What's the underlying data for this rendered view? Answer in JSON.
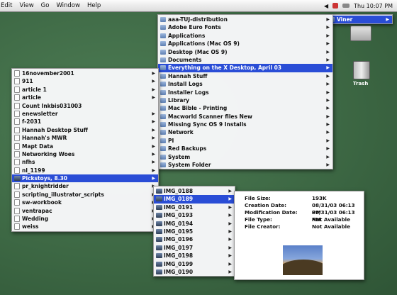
{
  "menubar": {
    "items": [
      "Edit",
      "View",
      "Go",
      "Window",
      "Help"
    ],
    "clock": "Thu 10:07 PM",
    "volume_icon": "speaker-icon",
    "flag_icon": "flag-icon",
    "battery_icon": "battery-icon"
  },
  "left_menu": {
    "items": [
      {
        "label": "16november2001",
        "icon": "doc",
        "arrow": true
      },
      {
        "label": "911",
        "icon": "doc",
        "arrow": true
      },
      {
        "label": "article 1",
        "icon": "doc",
        "arrow": true
      },
      {
        "label": "article",
        "icon": "doc",
        "arrow": true
      },
      {
        "label": "Count Inkbis031003",
        "icon": "doc",
        "arrow": false
      },
      {
        "label": "enewsletter",
        "icon": "doc",
        "arrow": true
      },
      {
        "label": "f-2031",
        "icon": "doc",
        "arrow": true
      },
      {
        "label": "Hannah Desktop Stuff",
        "icon": "doc",
        "arrow": true
      },
      {
        "label": "Hannah's MWR",
        "icon": "doc",
        "arrow": true
      },
      {
        "label": "Mapt Data",
        "icon": "doc",
        "arrow": true
      },
      {
        "label": "Networking Woes",
        "icon": "doc",
        "arrow": true
      },
      {
        "label": "nfhs",
        "icon": "doc",
        "arrow": true
      },
      {
        "label": "nl_1199",
        "icon": "doc",
        "arrow": true
      },
      {
        "label": "Pickstoys, 8.30",
        "icon": "img",
        "arrow": true,
        "selected": true
      },
      {
        "label": "pr_knightridder",
        "icon": "doc",
        "arrow": true
      },
      {
        "label": "scripting_illustrator_scripts",
        "icon": "doc",
        "arrow": true
      },
      {
        "label": "sw-workbook",
        "icon": "doc",
        "arrow": true
      },
      {
        "label": "ventrapac",
        "icon": "doc",
        "arrow": true
      },
      {
        "label": "Wedding",
        "icon": "doc",
        "arrow": true
      },
      {
        "label": "weiss",
        "icon": "doc",
        "arrow": true
      }
    ]
  },
  "middle_menu": {
    "items": [
      {
        "label": "aaa-TUJ-distribution",
        "icon": "folder",
        "arrow": true
      },
      {
        "label": "Adobe Euro Fonts",
        "icon": "folder",
        "arrow": true
      },
      {
        "label": "Applications",
        "icon": "folder",
        "arrow": true
      },
      {
        "label": "Applications (Mac OS 9)",
        "icon": "folder",
        "arrow": true
      },
      {
        "label": "Desktop (Mac OS 9)",
        "icon": "folder",
        "arrow": true
      },
      {
        "label": "Documents",
        "icon": "folder",
        "arrow": true
      },
      {
        "label": "Everything on the X Desktop, April 03",
        "icon": "folder",
        "arrow": true,
        "selected": true
      },
      {
        "label": "Hannah Stuff",
        "icon": "folder",
        "arrow": true
      },
      {
        "label": "Install Logs",
        "icon": "folder",
        "arrow": true
      },
      {
        "label": "Installer Logs",
        "icon": "folder",
        "arrow": true
      },
      {
        "label": "Library",
        "icon": "folder",
        "arrow": true
      },
      {
        "label": "Mac Bible - Printing",
        "icon": "folder",
        "arrow": true
      },
      {
        "label": "Macworld Scanner files New",
        "icon": "folder",
        "arrow": true
      },
      {
        "label": "Missing Sync OS 9 Installs",
        "icon": "folder",
        "arrow": true
      },
      {
        "label": "Network",
        "icon": "folder",
        "arrow": true
      },
      {
        "label": "PI",
        "icon": "folder",
        "arrow": true
      },
      {
        "label": "Red Backups",
        "icon": "folder",
        "arrow": true
      },
      {
        "label": "System",
        "icon": "folder",
        "arrow": true
      },
      {
        "label": "System Folder",
        "icon": "folder",
        "arrow": true
      }
    ]
  },
  "top_right_menu": {
    "items": [
      {
        "label": "Viner",
        "icon": "folder",
        "arrow": true,
        "selected": true
      }
    ]
  },
  "image_menu": {
    "items": [
      {
        "label": "IMG_0188",
        "icon": "img",
        "arrow": true
      },
      {
        "label": "IMG_0189",
        "icon": "img",
        "arrow": true,
        "selected": true
      },
      {
        "label": "IMG_0191",
        "icon": "img",
        "arrow": true
      },
      {
        "label": "IMG_0193",
        "icon": "img",
        "arrow": true
      },
      {
        "label": "IMG_0194",
        "icon": "img",
        "arrow": true
      },
      {
        "label": "IMG_0195",
        "icon": "img",
        "arrow": true
      },
      {
        "label": "IMG_0196",
        "icon": "img",
        "arrow": true
      },
      {
        "label": "IMG_0197",
        "icon": "img",
        "arrow": true
      },
      {
        "label": "IMG_0198",
        "icon": "img",
        "arrow": true
      },
      {
        "label": "IMG_0199",
        "icon": "img",
        "arrow": true
      },
      {
        "label": "IMG_0190",
        "icon": "img",
        "arrow": true
      }
    ]
  },
  "info_panel": {
    "rows": [
      {
        "key": "File Size:",
        "value": "193K"
      },
      {
        "key": "Creation Date:",
        "value": "08/31/03 06:13 PM"
      },
      {
        "key": "Modification Date:",
        "value": "08/31/03 06:13 PM"
      },
      {
        "key": "File Type:",
        "value": "Not Available"
      },
      {
        "key": "File Creator:",
        "value": "Not Available"
      }
    ],
    "preview_icon": "photo-preview-icon"
  },
  "desktop": {
    "icons": [
      {
        "label": "",
        "icon": "drive-icon"
      },
      {
        "label": "Trash",
        "icon": "trash-icon"
      }
    ]
  },
  "colors": {
    "selection": "#2a4dd6",
    "desktop": "#3f6b47"
  }
}
